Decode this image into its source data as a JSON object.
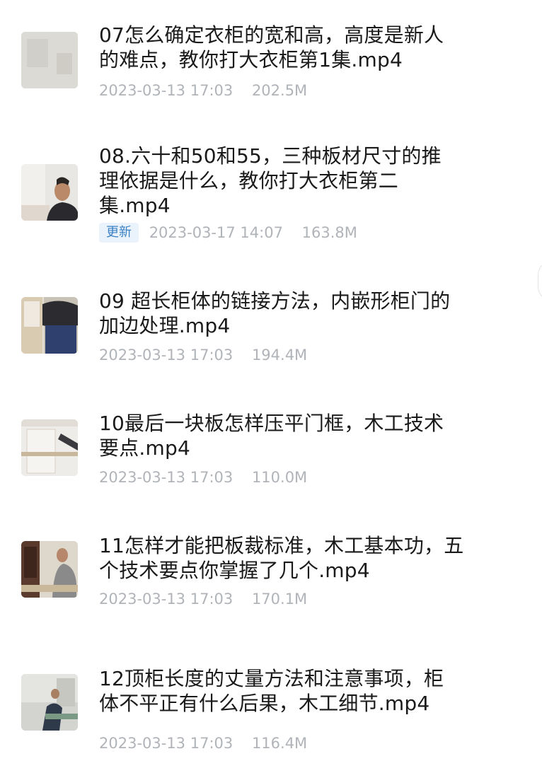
{
  "items": [
    {
      "title": "07怎么确定衣柜的宽和高，高度是新人\n的难点，教你打大衣柜第1集.mp4",
      "date": "2023-03-13 17:03",
      "size": "202.5M"
    },
    {
      "title": "08.六十和50和55，三种板材尺寸的推\n理依据是什么，教你打大衣柜第二\n集.mp4",
      "badge": "更新",
      "date": "2023-03-17 14:07",
      "size": "163.8M"
    },
    {
      "title": "09 超长柜体的链接方法，内嵌形柜门的\n加边处理.mp4",
      "date": "2023-03-13 17:03",
      "size": "194.4M"
    },
    {
      "title": "10最后一块板怎样压平门框，木工技术\n要点.mp4",
      "date": "2023-03-13 17:03",
      "size": "110.0M"
    },
    {
      "title": "11怎样才能把板裁标准，木工基本功，五\n个技术要点你掌握了几个.mp4",
      "date": "2023-03-13 17:03",
      "size": "170.1M"
    },
    {
      "title": "12顶柜长度的丈量方法和注意事项，柜\n体不平正有什么后果，木工细节.mp4",
      "date": "2023-03-13 17:03",
      "size": "116.4M"
    }
  ]
}
